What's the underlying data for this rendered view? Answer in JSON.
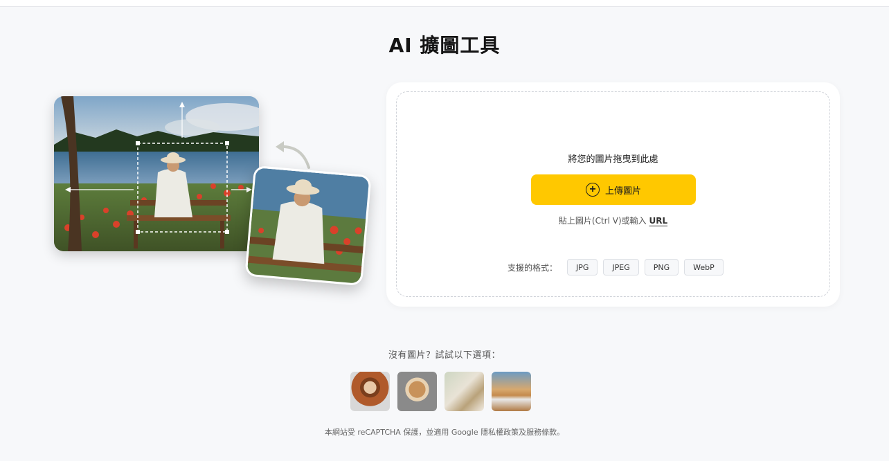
{
  "page": {
    "title": "AI 擴圖工具"
  },
  "upload": {
    "drop_text": "將您的圖片拖曳到此處",
    "button_label": "上傳圖片",
    "paste_text": "貼上圖片(Ctrl V)或輸入",
    "url_link": "URL",
    "formats_label": "支援的格式：",
    "formats": [
      "JPG",
      "JPEG",
      "PNG",
      "WebP"
    ]
  },
  "samples": {
    "label": "沒有圖片？試試以下選項：",
    "items": [
      "woman-portrait",
      "dog",
      "product-bottles",
      "car-desert"
    ]
  },
  "footer": {
    "recaptcha_note": "本網站受 reCAPTCHA 保護，並適用 Google 隱私權政策及服務條款。"
  },
  "colors": {
    "accent": "#ffc800",
    "background": "#f7f8fa"
  }
}
